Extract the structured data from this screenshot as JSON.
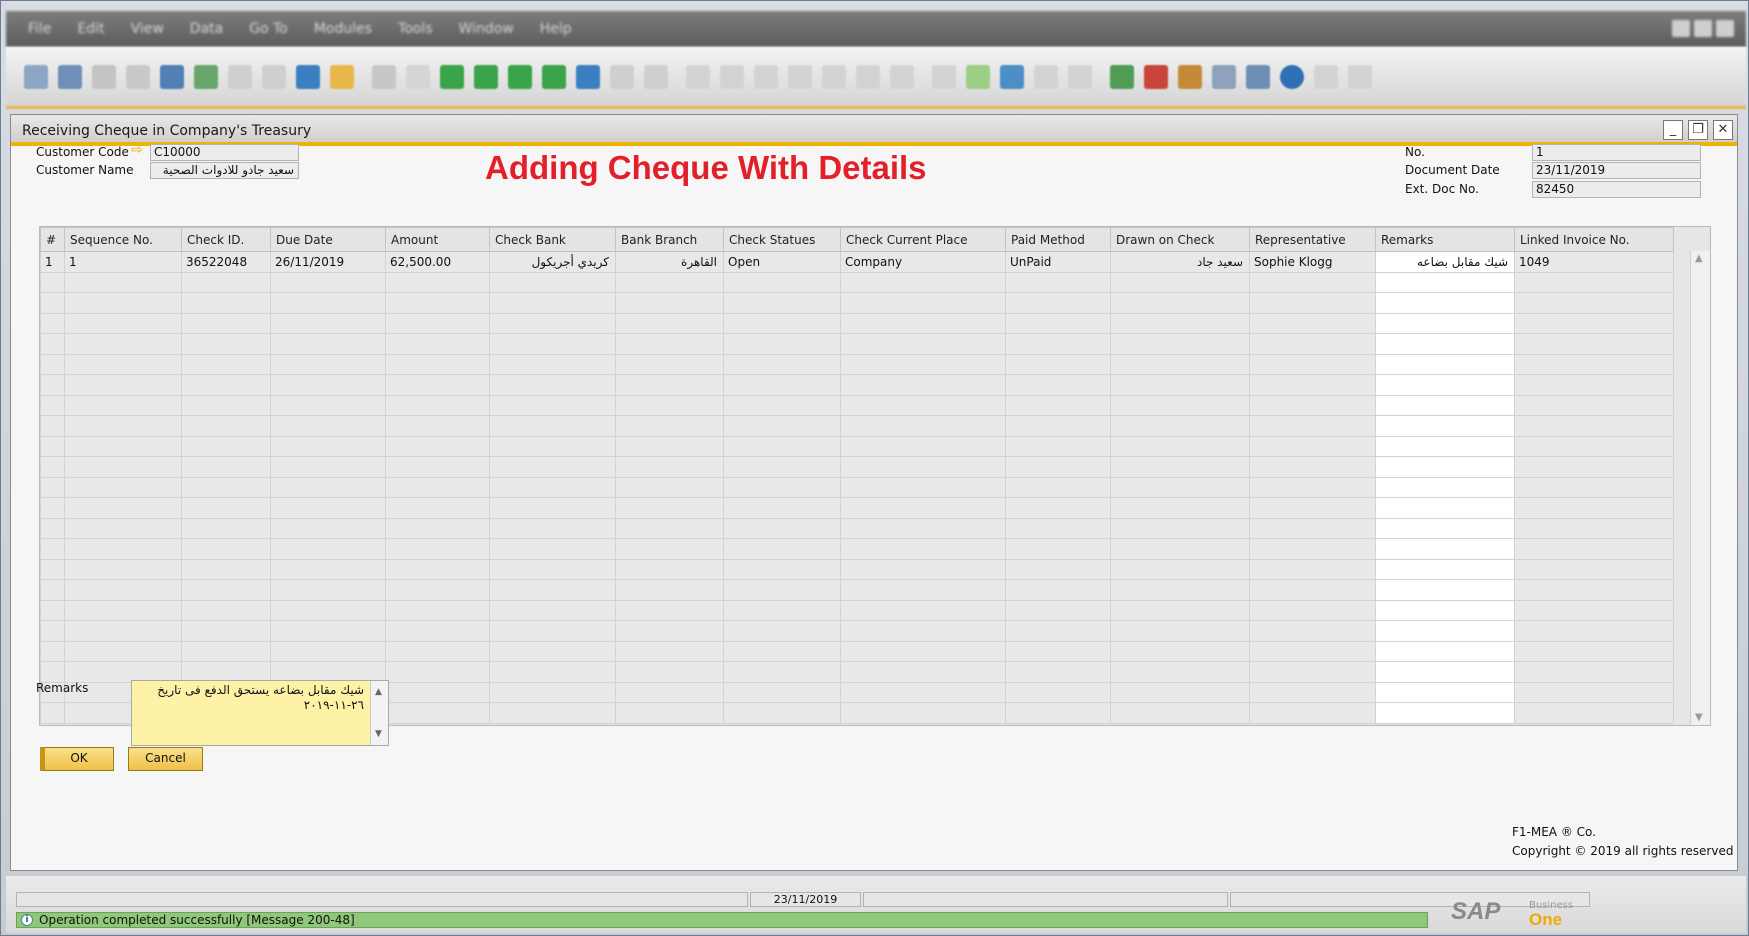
{
  "menu": [
    "File",
    "Edit",
    "View",
    "Data",
    "Go To",
    "Modules",
    "Tools",
    "Window",
    "Help"
  ],
  "window": {
    "title": "Receiving Cheque in Company's Treasury",
    "minimize": "_",
    "restore": "❐",
    "close": "✕"
  },
  "heading": "Adding Cheque With Details",
  "header": {
    "customer_code_label": "Customer Code",
    "customer_code": "C10000",
    "customer_name_label": "Customer Name",
    "customer_name": "سعيد جادو للادوات الصحية",
    "no_label": "No.",
    "no": "1",
    "document_date_label": "Document Date",
    "document_date": "23/11/2019",
    "ext_doc_label": "Ext. Doc No.",
    "ext_doc": "82450"
  },
  "table": {
    "columns": [
      "#",
      "Sequence No.",
      "Check ID.",
      "Due Date",
      "Amount",
      "Check Bank",
      "Bank Branch",
      "Check Statues",
      "Check Current Place",
      "Paid Method",
      "Drawn on Check",
      "Representative",
      "Remarks",
      "Linked Invoice No."
    ],
    "row": {
      "num": "1",
      "sequence": "1",
      "check_id": "36522048",
      "due_date": "26/11/2019",
      "amount": "62,500.00",
      "check_bank": "كريدي أجريكول",
      "bank_branch": "القاهرة",
      "status": "Open",
      "current_place": "Company",
      "paid_method": "UnPaid",
      "drawn_on": "سعيد جاد",
      "representative": "Sophie Klogg",
      "remarks": "شيك مقابل بضاعه",
      "linked_invoice": "1049"
    }
  },
  "remarks": {
    "label": "Remarks",
    "text": "شيك مقابل بضاعه يستحق الدفع فى تاريخ ٢٦-١١-٢٠١٩"
  },
  "buttons": {
    "ok": "OK",
    "cancel": "Cancel"
  },
  "copyright": {
    "company": "F1-MEA ® Co.",
    "line": "Copyright © 2019 all rights reserved"
  },
  "status": {
    "date": "23/11/2019",
    "message": "Operation completed successfully  [Message 200-48]"
  },
  "logo": {
    "sap": "SAP",
    "business": "Business",
    "one": "One"
  },
  "colors": {
    "accent": "#f2b200",
    "heading": "#e3202a",
    "success": "#8fc87a"
  }
}
